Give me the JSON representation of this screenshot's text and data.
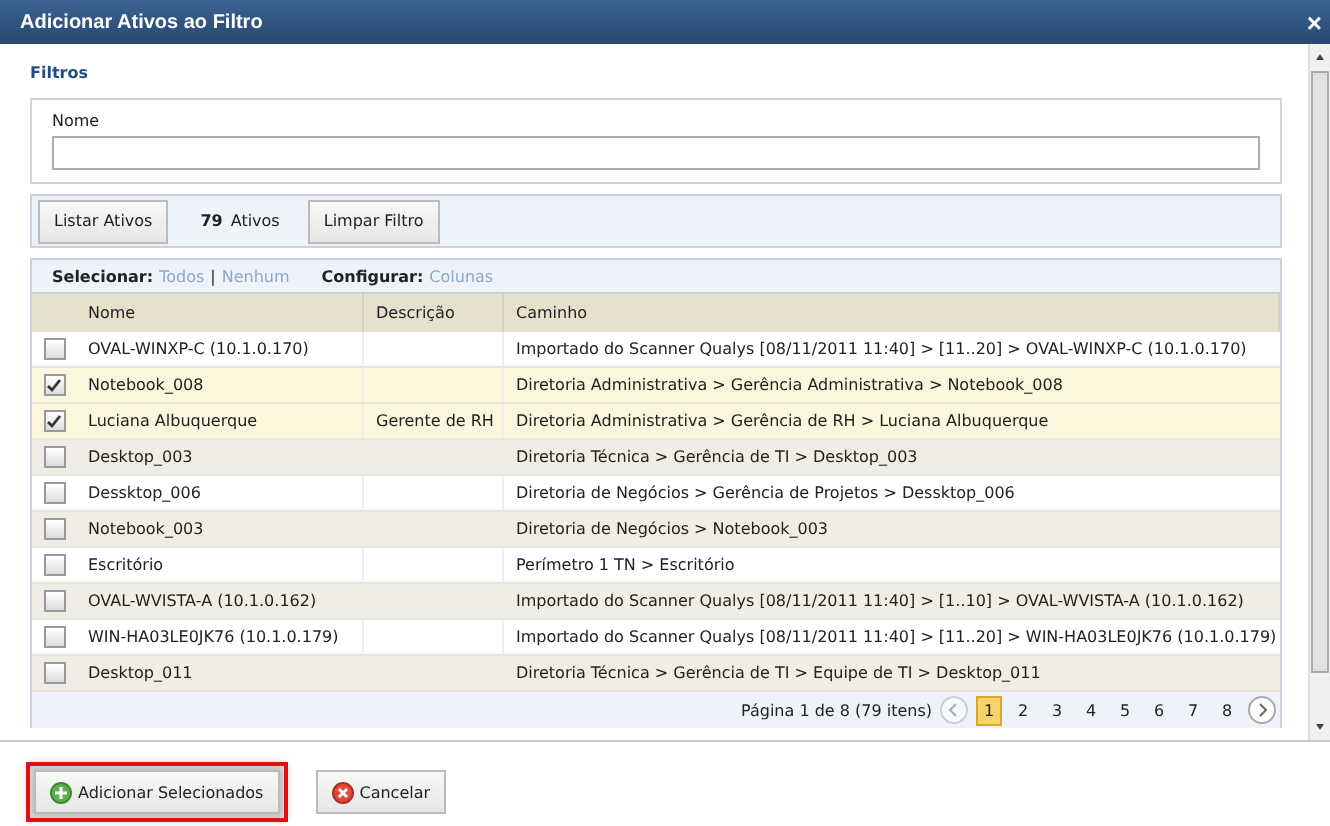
{
  "window": {
    "title": "Adicionar Ativos ao Filtro",
    "close": "×"
  },
  "filters": {
    "heading": "Filtros",
    "name_label": "Nome"
  },
  "toolbar": {
    "list_button": "Listar Ativos",
    "count": "79",
    "count_label": "Ativos",
    "clear_button": "Limpar Filtro"
  },
  "grid_bar": {
    "select_label": "Selecionar:",
    "select_all": "Todos",
    "separator": "|",
    "select_none": "Nenhum",
    "configure_label": "Configurar:",
    "columns_link": "Colunas"
  },
  "table": {
    "columns": [
      "Nome",
      "Descrição",
      "Caminho"
    ],
    "rows": [
      {
        "checked": false,
        "cells": [
          "OVAL-WINXP-C (10.1.0.170)",
          "",
          "Importado do Scanner Qualys [08/11/2011 11:40] > [11..20] > OVAL-WINXP-C (10.1.0.170)"
        ]
      },
      {
        "checked": true,
        "cells": [
          "Notebook_008",
          "",
          "Diretoria Administrativa > Gerência Administrativa > Notebook_008"
        ]
      },
      {
        "checked": true,
        "cells": [
          "Luciana Albuquerque",
          "Gerente de RH",
          "Diretoria Administrativa > Gerência de RH > Luciana Albuquerque"
        ]
      },
      {
        "checked": false,
        "cells": [
          "Desktop_003",
          "",
          "Diretoria Técnica > Gerência de TI > Desktop_003"
        ]
      },
      {
        "checked": false,
        "cells": [
          "Dessktop_006",
          "",
          "Diretoria de Negócios > Gerência de Projetos > Dessktop_006"
        ]
      },
      {
        "checked": false,
        "cells": [
          "Notebook_003",
          "",
          "Diretoria de Negócios > Notebook_003"
        ]
      },
      {
        "checked": false,
        "cells": [
          "Escritório",
          "",
          "Perímetro 1 TN > Escritório"
        ]
      },
      {
        "checked": false,
        "cells": [
          "OVAL-WVISTA-A (10.1.0.162)",
          "",
          "Importado do Scanner Qualys [08/11/2011 11:40] > [1..10] > OVAL-WVISTA-A (10.1.0.162)"
        ]
      },
      {
        "checked": false,
        "cells": [
          "WIN-HA03LE0JK76 (10.1.0.179)",
          "",
          "Importado do Scanner Qualys [08/11/2011 11:40] > [11..20] > WIN-HA03LE0JK76 (10.1.0.179)"
        ]
      },
      {
        "checked": false,
        "cells": [
          "Desktop_011",
          "",
          "Diretoria Técnica > Gerência de TI > Equipe de TI > Desktop_011"
        ]
      }
    ]
  },
  "pagination": {
    "summary": "Página 1 de 8 (79 itens)",
    "pages": [
      {
        "label": "1",
        "selected": true
      },
      {
        "label": "2",
        "selected": false
      },
      {
        "label": "3",
        "selected": false
      },
      {
        "label": "4",
        "selected": false
      },
      {
        "label": "5",
        "selected": false
      },
      {
        "label": "6",
        "selected": false
      },
      {
        "label": "7",
        "selected": false
      },
      {
        "label": "8",
        "selected": false
      }
    ]
  },
  "footer": {
    "buttons": [
      {
        "kind": "add",
        "label": "Adicionar Selecionados",
        "highlighted": true
      },
      {
        "kind": "cancel",
        "label": "Cancelar",
        "highlighted": false
      }
    ]
  }
}
